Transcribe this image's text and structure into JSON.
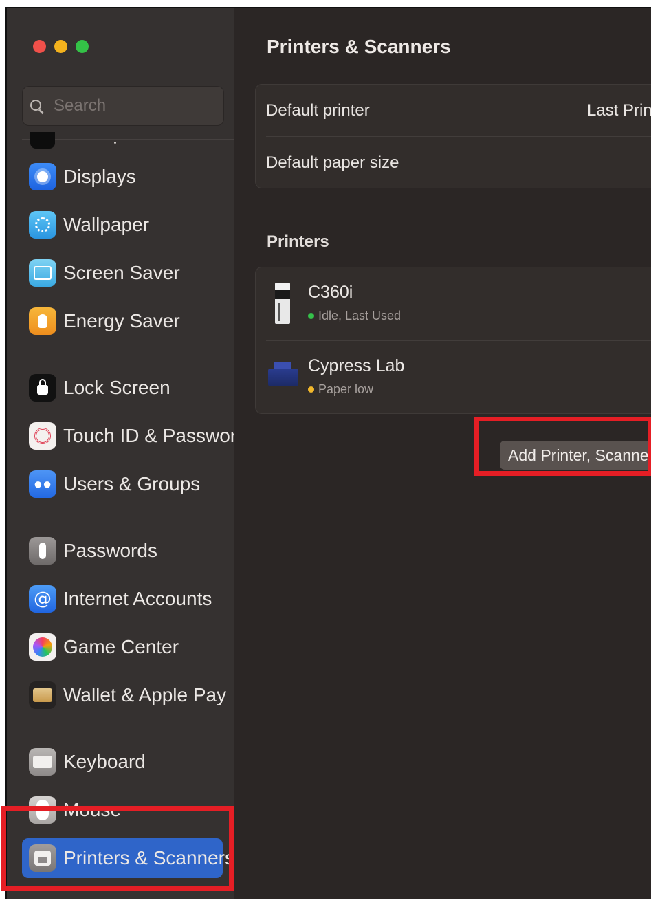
{
  "window": {
    "title": "Printers & Scanners",
    "traffic_lights": {
      "close": "#f0504a",
      "minimize": "#f4b21d",
      "maximize": "#34c247"
    }
  },
  "sidebar": {
    "search": {
      "placeholder": "Search",
      "value": "",
      "icon": "search-icon"
    },
    "items": [
      {
        "id": "displays",
        "label": "Displays",
        "icon": "sun-icon",
        "color": "#2f78ee"
      },
      {
        "id": "wallpaper",
        "label": "Wallpaper",
        "icon": "flower-icon",
        "color": "#3aa6e8"
      },
      {
        "id": "screen-saver",
        "label": "Screen Saver",
        "icon": "screen-icon",
        "color": "#52bdea"
      },
      {
        "id": "energy-saver",
        "label": "Energy Saver",
        "icon": "bulb-icon",
        "color": "#f3a12b"
      },
      {
        "id": "lock-screen",
        "label": "Lock Screen",
        "icon": "lock-icon",
        "color": "#111111"
      },
      {
        "id": "touch-id",
        "label": "Touch ID & Password",
        "icon": "fingerprint-icon",
        "color": "#e0465a"
      },
      {
        "id": "users-groups",
        "label": "Users & Groups",
        "icon": "people-icon",
        "color": "#3a80ec"
      },
      {
        "id": "passwords",
        "label": "Passwords",
        "icon": "key-icon",
        "color": "#858180"
      },
      {
        "id": "internet-accounts",
        "label": "Internet Accounts",
        "icon": "at-icon",
        "color": "#3780eb"
      },
      {
        "id": "game-center",
        "label": "Game Center",
        "icon": "game-center-icon",
        "color": "#f3f0ef"
      },
      {
        "id": "wallet",
        "label": "Wallet & Apple Pay",
        "icon": "wallet-icon",
        "color": "#262322"
      },
      {
        "id": "keyboard",
        "label": "Keyboard",
        "icon": "keyboard-icon",
        "color": "#a4a09e"
      },
      {
        "id": "mouse",
        "label": "Mouse",
        "icon": "mouse-icon",
        "color": "#c0bcba"
      },
      {
        "id": "printers-scanners",
        "label": "Printers & Scanners",
        "icon": "printer-icon",
        "color": "#8e8a89",
        "selected": true
      }
    ],
    "selected_color": "#2f65c9"
  },
  "main": {
    "title": "Printers & Scanners",
    "defaults": {
      "default_printer_label": "Default printer",
      "default_printer_value": "Last Printe",
      "paper_size_label": "Default paper size"
    },
    "printers_section_title": "Printers",
    "printers": [
      {
        "name": "C360i",
        "status": "Idle, Last Used",
        "status_color": "#35c14a"
      },
      {
        "name": "Cypress Lab",
        "status": "Paper low",
        "status_color": "#f1b72b"
      }
    ],
    "add_button_label": "Add Printer, Scanner or"
  },
  "annotations": {
    "highlight_color": "#e51e25"
  }
}
